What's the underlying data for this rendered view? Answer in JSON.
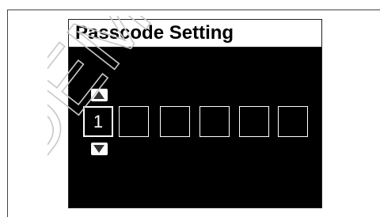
{
  "screen": {
    "title": "Passcode Setting",
    "colors": {
      "background": "#000000",
      "title_bar": "#ffffff",
      "text": "#ffffff",
      "watermark": "#c8c8c8"
    }
  },
  "passcode": {
    "digit_1": "1",
    "digit_2": "",
    "digit_3": "",
    "digit_4": "",
    "digit_5": "",
    "digit_6": "",
    "active_index": 0
  },
  "icons": {
    "up": "arrow-up-icon",
    "down": "arrow-down-icon"
  },
  "watermark": {
    "text": "DEMO"
  }
}
